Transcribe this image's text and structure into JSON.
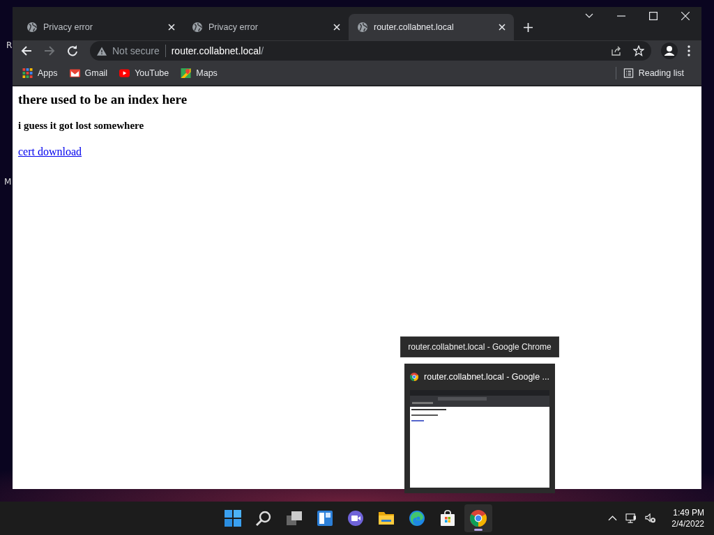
{
  "desktop": {
    "icon_labels": [
      "R",
      "M"
    ]
  },
  "browser": {
    "tabs": [
      {
        "title": "Privacy error",
        "selected": false
      },
      {
        "title": "Privacy error",
        "selected": false
      },
      {
        "title": "router.collabnet.local",
        "selected": true
      }
    ],
    "security_label": "Not secure",
    "url_host": "router.collabnet.local",
    "url_path": "/",
    "bookmarks": [
      {
        "kind": "apps",
        "label": "Apps"
      },
      {
        "kind": "gmail",
        "label": "Gmail"
      },
      {
        "kind": "youtube",
        "label": "YouTube"
      },
      {
        "kind": "maps",
        "label": "Maps"
      }
    ],
    "reading_list": "Reading list"
  },
  "page": {
    "heading": "there used to be an index here",
    "subheading": "i guess it got lost somewhere",
    "link": "cert download"
  },
  "tooltip": "router.collabnet.local - Google Chrome",
  "thumbnail": {
    "title": "router.collabnet.local - Google ..."
  },
  "taskbar": {
    "apps": [
      {
        "kind": "start",
        "active": false
      },
      {
        "kind": "search",
        "active": false
      },
      {
        "kind": "taskview",
        "active": false
      },
      {
        "kind": "widgets",
        "active": false
      },
      {
        "kind": "chat",
        "active": false
      },
      {
        "kind": "explorer",
        "active": false
      },
      {
        "kind": "edge",
        "active": false
      },
      {
        "kind": "store",
        "active": false
      },
      {
        "kind": "chrome",
        "active": true
      }
    ],
    "time": "1:49 PM",
    "date": "2/4/2022"
  }
}
